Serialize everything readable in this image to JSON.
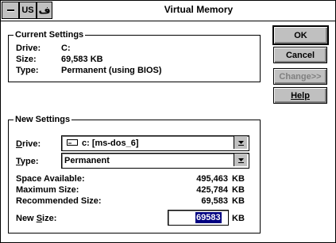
{
  "window": {
    "title": "Virtual Memory",
    "sysmenu": "system-menu",
    "lang_indicator": "US",
    "ime_glyph": "ف"
  },
  "current": {
    "heading": "Current Settings",
    "drive_label": "Drive:",
    "drive_value": "C:",
    "size_label": "Size:",
    "size_value": "69,583 KB",
    "type_label": "Type:",
    "type_value": "Permanent (using BIOS)"
  },
  "buttons": {
    "ok": "OK",
    "cancel": "Cancel",
    "change": "Change>>",
    "help": "Help"
  },
  "new": {
    "heading": "New Settings",
    "drive_label_mn": "D",
    "drive_label_rest": "rive:",
    "drive_value": "c: [ms-dos_6]",
    "type_label_mn": "T",
    "type_label_rest": "ype:",
    "type_value": "Permanent",
    "space_label": "Space Available:",
    "space_value": "495,463",
    "max_label": "Maximum Size:",
    "max_value": "425,784",
    "rec_label": "Recommended Size:",
    "rec_value": "69,583",
    "kb": "KB",
    "newsize_label_pre": "New ",
    "newsize_label_mn": "S",
    "newsize_label_rest": "ize:",
    "newsize_value": "69583"
  },
  "colors": {
    "face": "#c0c0c0",
    "selection": "#000080"
  }
}
